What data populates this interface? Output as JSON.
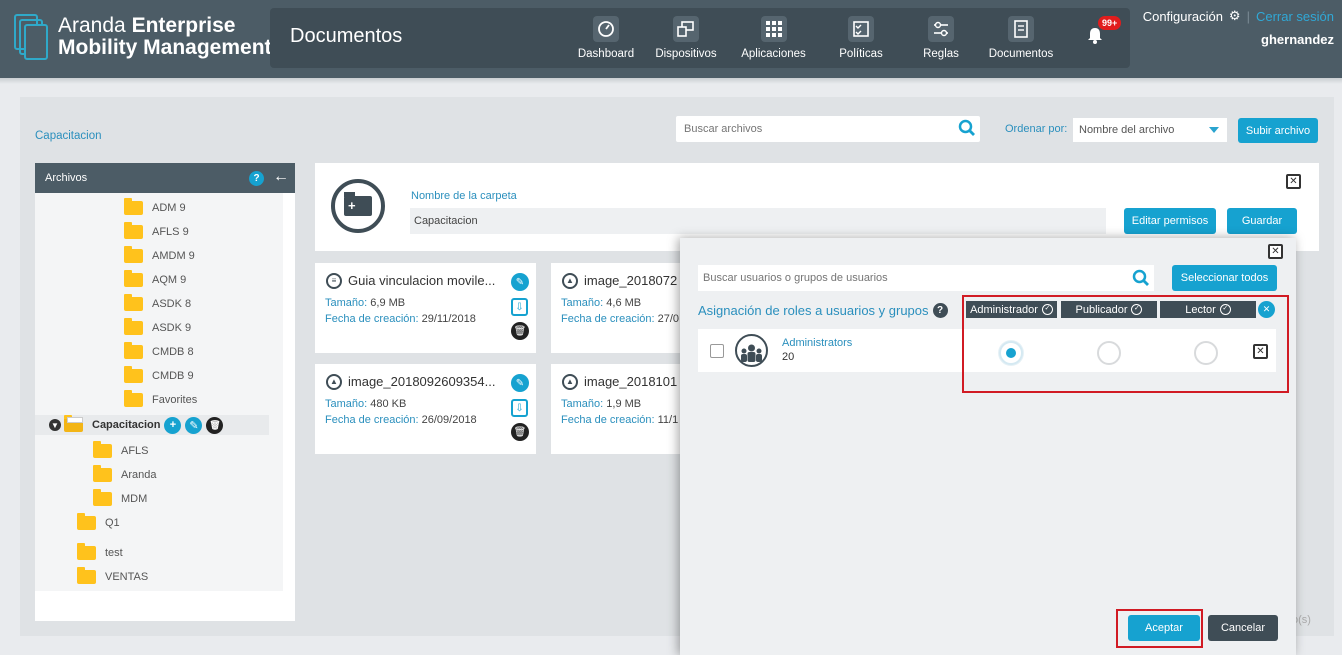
{
  "brand": {
    "line1_light": "Aranda ",
    "line1_bold": "Enterprise",
    "line2": "Mobility Management"
  },
  "header": {
    "page_title": "Documentos",
    "nav": [
      {
        "label": "Dashboard",
        "icon": "dashboard-icon"
      },
      {
        "label": "Dispositivos",
        "icon": "devices-icon"
      },
      {
        "label": "Aplicaciones",
        "icon": "apps-grid-icon"
      },
      {
        "label": "Políticas",
        "icon": "policies-icon"
      },
      {
        "label": "Reglas",
        "icon": "rules-icon"
      },
      {
        "label": "Documentos",
        "icon": "documents-icon"
      }
    ],
    "notifications_badge": "99+",
    "config_label": "Configuración",
    "logout_label": "Cerrar sesión",
    "username": "ghernandez"
  },
  "toolbar": {
    "breadcrumb": "Capacitacion",
    "search_placeholder": "Buscar archivos",
    "order_label": "Ordenar por:",
    "order_value": "Nombre del archivo",
    "upload_label": "Subir archivo"
  },
  "sidebar": {
    "title": "Archivos",
    "help": "?",
    "items": [
      {
        "label": "ADM 9"
      },
      {
        "label": "AFLS 9"
      },
      {
        "label": "AMDM 9"
      },
      {
        "label": "AQM 9"
      },
      {
        "label": "ASDK 8"
      },
      {
        "label": "ASDK 9"
      },
      {
        "label": "CMDB 8"
      },
      {
        "label": "CMDB 9"
      },
      {
        "label": "Favorites"
      },
      {
        "label": "Capacitacion"
      },
      {
        "label": "AFLS"
      },
      {
        "label": "Aranda"
      },
      {
        "label": "MDM"
      },
      {
        "label": "Q1"
      },
      {
        "label": "test"
      },
      {
        "label": "VENTAS"
      }
    ]
  },
  "folder_panel": {
    "name_label": "Nombre de la carpeta",
    "name_value": "Capacitacion",
    "edit_permissions_label": "Editar permisos",
    "save_label": "Guardar"
  },
  "files": [
    {
      "title": "Guia vinculacion movile...",
      "size_label": "Tamaño:",
      "size": "6,9 MB",
      "date_label": "Fecha de creación:",
      "date": "29/11/2018"
    },
    {
      "title": "image_2018072",
      "size_label": "Tamaño:",
      "size": "4,6 MB",
      "date_label": "Fecha de creación:",
      "date": "27/0"
    },
    {
      "title": "image_2018092609354...",
      "size_label": "Tamaño:",
      "size": "480 KB",
      "date_label": "Fecha de creación:",
      "date": "26/09/2018"
    },
    {
      "title": "image_2018101",
      "size_label": "Tamaño:",
      "size": "1,9 MB",
      "date_label": "Fecha de creación:",
      "date": "11/1"
    }
  ],
  "pager_text": "o(s)",
  "modal": {
    "search_placeholder": "Buscar usuarios o grupos de usuarios",
    "select_all_label": "Seleccionar todos",
    "roles_title": "Asignación de roles a usuarios y grupos",
    "roles": [
      "Administrador",
      "Publicador",
      "Lector"
    ],
    "users": [
      {
        "name": "Administrators",
        "count": "20",
        "role": "Administrador"
      }
    ],
    "accept_label": "Aceptar",
    "cancel_label": "Cancelar"
  },
  "colors": {
    "accent": "#16a2d0",
    "header": "#4c5c66",
    "highlight": "#d11b24",
    "folder": "#ffc21c"
  }
}
